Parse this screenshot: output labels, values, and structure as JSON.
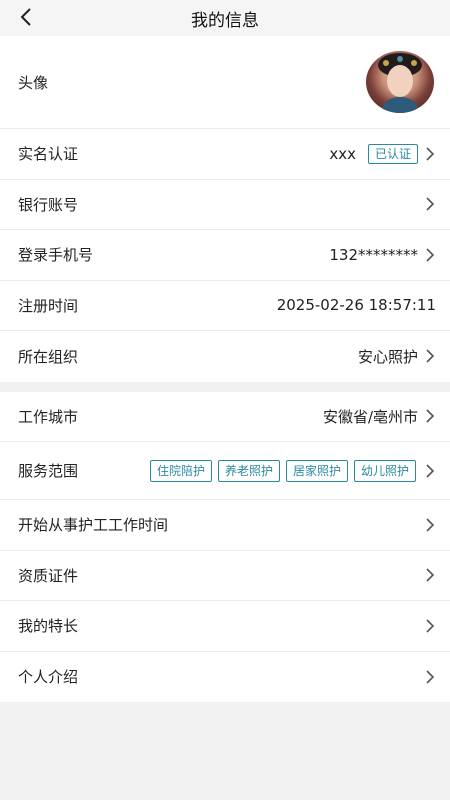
{
  "header": {
    "title": "我的信息"
  },
  "profile": {
    "avatar_label": "头像",
    "realname_label": "实名认证",
    "realname_value": "xxx",
    "realname_badge": "已认证",
    "bank_label": "银行账号",
    "phone_label": "登录手机号",
    "phone_value": "132********",
    "register_label": "注册时间",
    "register_value": "2025-02-26 18:57:11",
    "org_label": "所在组织",
    "org_value": "安心照护"
  },
  "work": {
    "city_label": "工作城市",
    "city_value": "安徽省/亳州市",
    "scope_label": "服务范围",
    "scope_tags": [
      "住院陪护",
      "养老照护",
      "居家照护",
      "幼儿照护"
    ],
    "start_label": "开始从事护工工作时间",
    "cert_label": "资质证件",
    "skill_label": "我的特长",
    "intro_label": "个人介绍"
  },
  "colors": {
    "accent": "#2a8aa0",
    "background": "#f2f2f2"
  },
  "icons": {
    "back": "chevron-left-icon",
    "arrow": "chevron-right-icon"
  }
}
